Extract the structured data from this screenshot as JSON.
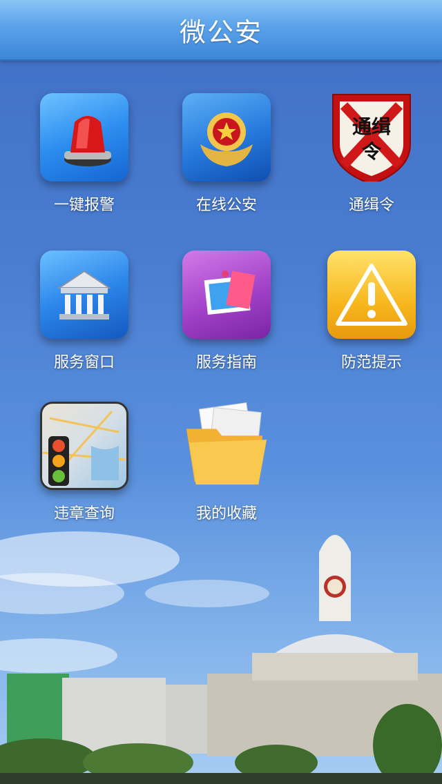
{
  "header": {
    "title": "微公安"
  },
  "menu": {
    "items": [
      {
        "label": "一键报警",
        "icon": "siren-icon"
      },
      {
        "label": "在线公安",
        "icon": "police-badge-icon"
      },
      {
        "label": "通缉令",
        "icon": "wanted-shield-icon"
      },
      {
        "label": "服务窗口",
        "icon": "bank-building-icon"
      },
      {
        "label": "服务指南",
        "icon": "photo-notes-icon"
      },
      {
        "label": "防范提示",
        "icon": "warning-icon"
      },
      {
        "label": "违章查询",
        "icon": "traffic-light-map-icon"
      },
      {
        "label": "我的收藏",
        "icon": "folder-icon"
      }
    ]
  },
  "wanted_icon_text": {
    "line1": "通缉",
    "line2": "令"
  },
  "colors": {
    "header_gradient_top": "#8ac4f6",
    "header_gradient_bottom": "#3c86d8",
    "background_top": "#3f6fc6",
    "background_bottom": "#a8cdf2"
  }
}
